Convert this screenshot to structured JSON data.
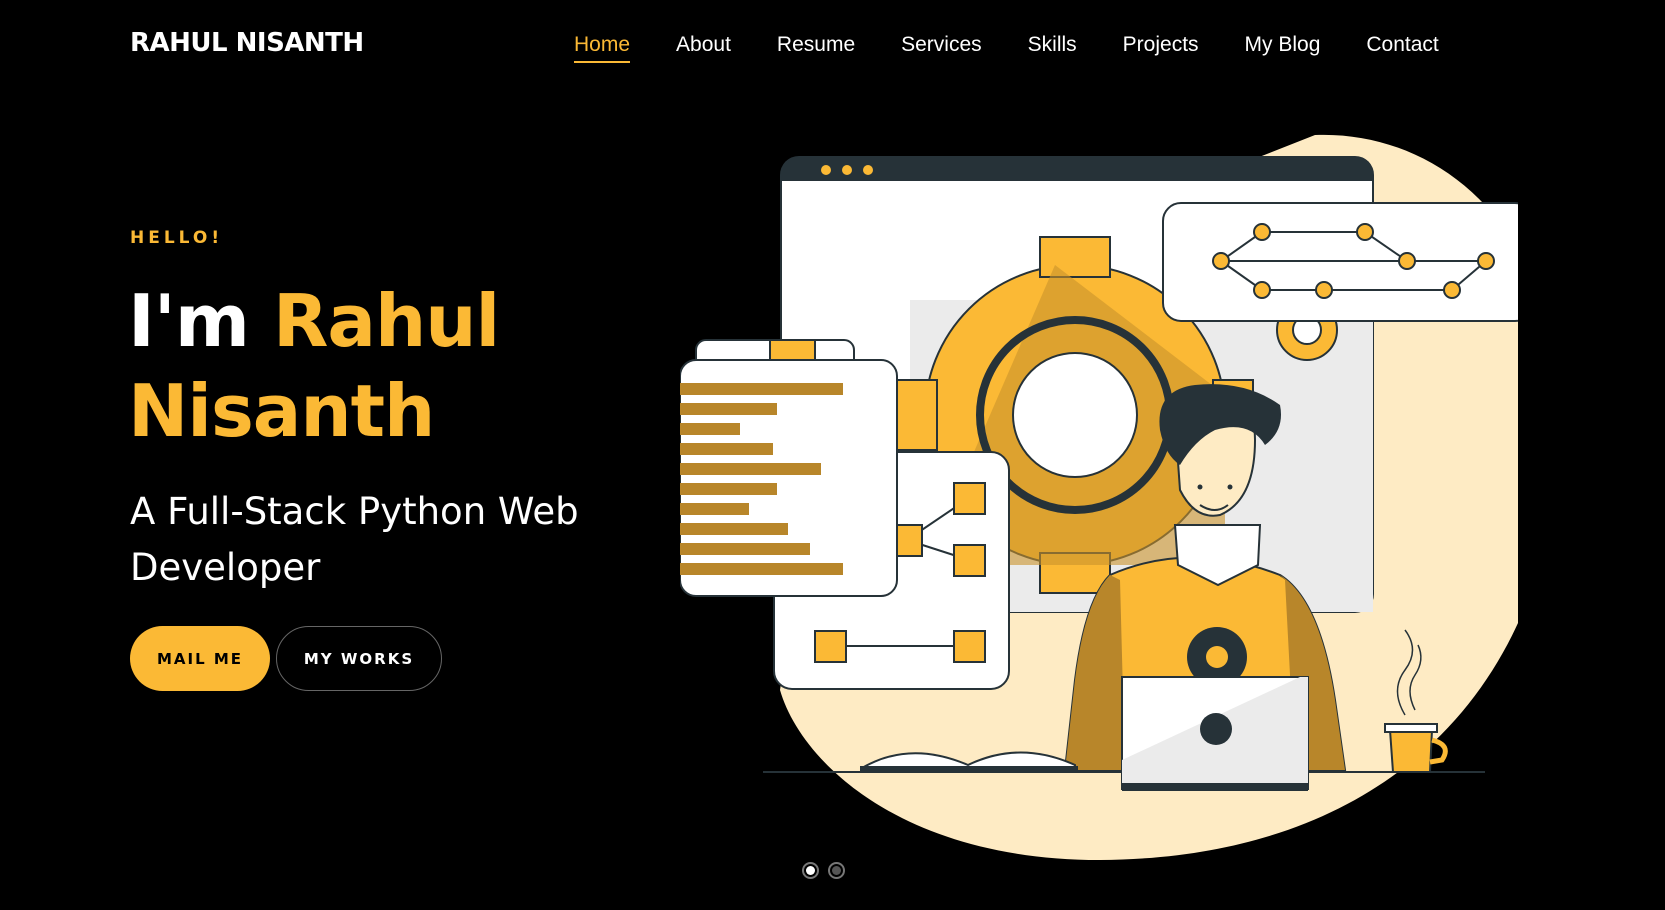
{
  "header": {
    "logo": "RAHUL NISANTH",
    "nav": [
      "Home",
      "About",
      "Resume",
      "Services",
      "Skills",
      "Projects",
      "My Blog",
      "Contact"
    ],
    "active_index": 0
  },
  "hero": {
    "greeting": "HELLO!",
    "headline_prefix": "I'm",
    "headline_first": "Rahul",
    "headline_last": "Nisanth",
    "subtitle": "A Full-Stack Python Web Developer",
    "buttons": {
      "primary": "MAIL ME",
      "secondary": "MY WORKS"
    }
  },
  "carousel": {
    "slides": 2,
    "active": 0
  },
  "colors": {
    "accent": "#fbb935",
    "background": "#000000",
    "cream": "#feebc4",
    "dark": "#263238"
  }
}
